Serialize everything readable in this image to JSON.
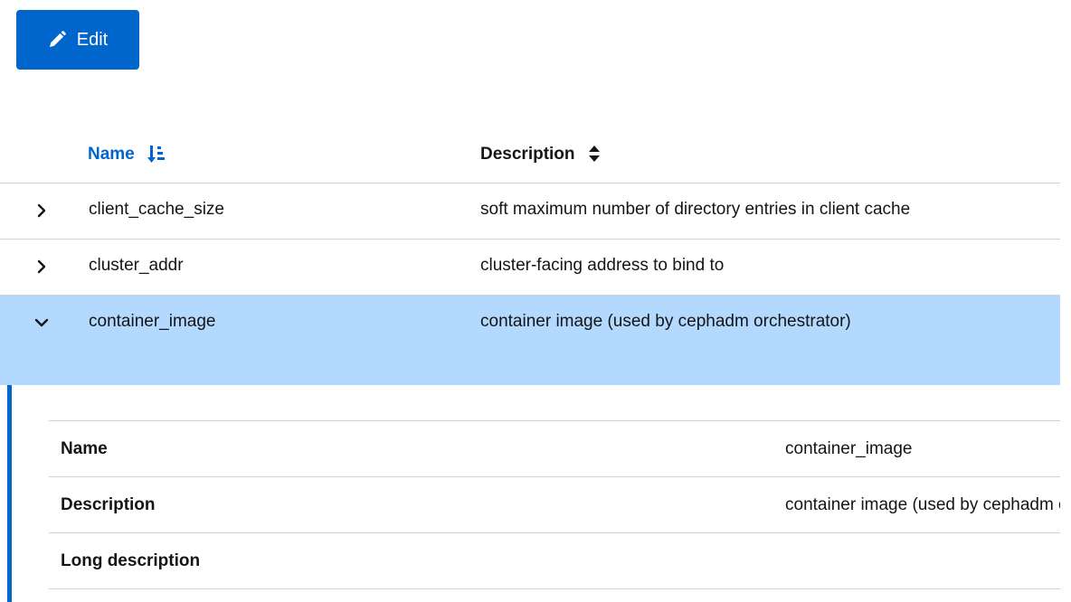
{
  "toolbar": {
    "edit_label": "Edit",
    "edit_icon": "pencil-icon",
    "accent_color": "#0066cc"
  },
  "table": {
    "columns": [
      {
        "label": "Name",
        "sort_icon": "sort-amount-down-icon",
        "active": true
      },
      {
        "label": "Description",
        "sort_icon": "sort-icon",
        "active": false
      }
    ],
    "rows": [
      {
        "name": "client_cache_size",
        "description": "soft maximum number of directory entries in client cache",
        "expanded": false
      },
      {
        "name": "cluster_addr",
        "description": "cluster-facing address to bind to",
        "expanded": false
      },
      {
        "name": "container_image",
        "description": "container image (used by cephadm orchestrator)",
        "expanded": true
      }
    ],
    "selected_row_color": "#b3d9ff"
  },
  "details": {
    "rows": [
      {
        "label": "Name",
        "value": "container_image"
      },
      {
        "label": "Description",
        "value": "container image (used by cephadm orchestrator)"
      },
      {
        "label": "Long description",
        "value": ""
      }
    ]
  }
}
